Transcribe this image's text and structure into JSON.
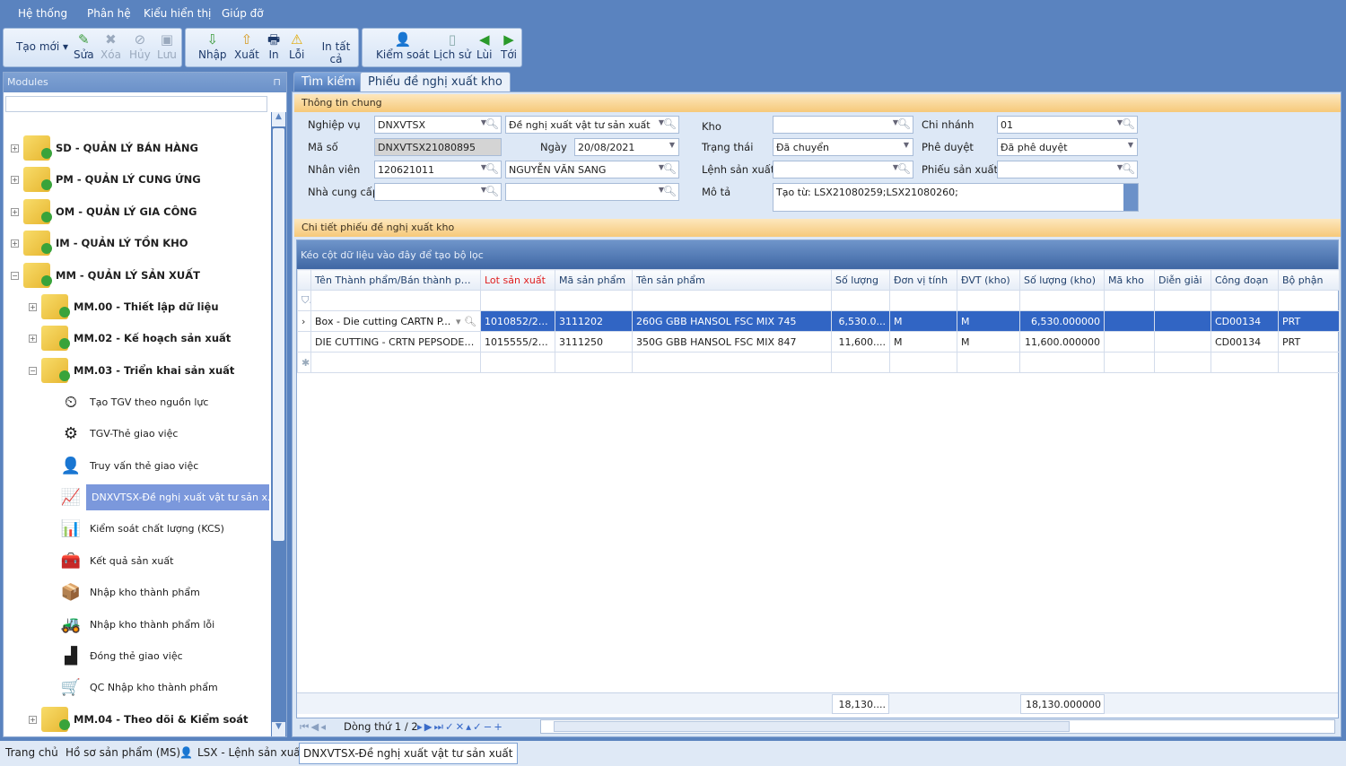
{
  "menu": [
    "Hệ thống",
    "Phân hệ",
    "Kiểu hiển thị",
    "Giúp đỡ"
  ],
  "toolbar": {
    "group1": [
      {
        "label": "Tạo mới ▾",
        "icon": "new-icon",
        "enabled": true
      },
      {
        "label": "Sửa",
        "icon": "pencil-icon",
        "enabled": true
      },
      {
        "label": "Xóa",
        "icon": "delete-icon",
        "enabled": false
      },
      {
        "label": "Hủy",
        "icon": "cancel-icon",
        "enabled": false
      },
      {
        "label": "Lưu",
        "icon": "save-icon",
        "enabled": false
      }
    ],
    "group2": [
      {
        "label": "Nhập",
        "icon": "import-icon"
      },
      {
        "label": "Xuất",
        "icon": "export-icon"
      },
      {
        "label": "In",
        "icon": "printer-icon"
      },
      {
        "label": "Lỗi",
        "icon": "warning-icon"
      },
      {
        "label": "In tất cả",
        "icon": ""
      }
    ],
    "group3": [
      {
        "label": "Kiểm soát",
        "icon": "user-icon"
      },
      {
        "label": "Lịch sử",
        "icon": "history-icon"
      },
      {
        "label": "Lùi",
        "icon": "back-icon"
      },
      {
        "label": "Tới",
        "icon": "forward-icon"
      }
    ]
  },
  "modules": {
    "title": "Modules",
    "pin": "⊓",
    "tree": [
      {
        "label": "SD - QUẢN LÝ BÁN HÀNG",
        "level": 0,
        "bold": true
      },
      {
        "label": "PM - QUẢN LÝ CUNG ỨNG",
        "level": 0,
        "bold": true
      },
      {
        "label": "OM - QUẢN LÝ GIA CÔNG",
        "level": 0,
        "bold": true
      },
      {
        "label": "IM - QUẢN LÝ TỒN KHO",
        "level": 0,
        "bold": true
      },
      {
        "label": "MM - QUẢN LÝ SẢN XUẤT",
        "level": 0,
        "bold": true
      },
      {
        "label": "MM.00 - Thiết lập dữ liệu",
        "level": 1,
        "bold": true
      },
      {
        "label": "MM.02 - Kế hoạch sản xuất",
        "level": 1,
        "bold": true
      },
      {
        "label": "MM.03 - Triển khai sản xuất",
        "level": 1,
        "bold": true
      },
      {
        "label": "Tạo TGV theo nguồn lực",
        "level": 2,
        "icon": "gauge-icon"
      },
      {
        "label": "TGV-Thẻ giao việc",
        "level": 2,
        "icon": "machine-icon"
      },
      {
        "label": "Truy vấn thẻ giao việc",
        "level": 2,
        "icon": "user-key-icon"
      },
      {
        "label": "DNXVTSX-Đề nghị xuất vật tư sản x...",
        "level": 2,
        "icon": "chart-board-icon",
        "selected": true
      },
      {
        "label": "Kiểm soát chất lượng (KCS)",
        "level": 2,
        "icon": "plan-icon"
      },
      {
        "label": "Kết quả sản xuất",
        "level": 2,
        "icon": "toolbox-icon"
      },
      {
        "label": "Nhập kho thành phẩm",
        "level": 2,
        "icon": "box-in-icon"
      },
      {
        "label": "Nhập kho thành phẩm lỗi",
        "level": 2,
        "icon": "forklift-icon"
      },
      {
        "label": "Đóng thẻ giao việc",
        "level": 2,
        "icon": "area-chart-icon"
      },
      {
        "label": "QC Nhập kho thành phẩm",
        "level": 2,
        "icon": "cart-icon"
      },
      {
        "label": "MM.04 - Theo dõi & Kiểm soát",
        "level": 1,
        "bold": true
      }
    ]
  },
  "tabs": [
    {
      "label": "Tìm kiếm",
      "active": false
    },
    {
      "label": "Phiếu đề nghị xuất kho",
      "active": true
    }
  ],
  "general": {
    "title": "Thông tin chung",
    "nghiep_vu_label": "Nghiệp vụ",
    "nghiep_vu_code": "DNXVTSX",
    "nghiep_vu_name": "Đề nghị xuất vật tư sản xuất",
    "ma_so_label": "Mã số",
    "ma_so": "DNXVTSX21080895",
    "ngay_label": "Ngày",
    "ngay": "20/08/2021",
    "nhan_vien_label": "Nhân viên",
    "nhan_vien_code": "120621011",
    "nhan_vien_name": "NGUYỄN VĂN SANG",
    "ncc_label": "Nhà cung cấp",
    "ncc_code": "",
    "ncc_name": "",
    "kho_label": "Kho",
    "kho": "",
    "trang_thai_label": "Trạng thái",
    "trang_thai": "Đã chuyển",
    "lsx_label": "Lệnh sản xuất",
    "lsx": "",
    "mo_ta_label": "Mô tả",
    "mo_ta": "Tạo từ: LSX21080259;LSX21080260;",
    "chi_nhanh_label": "Chi nhánh",
    "chi_nhanh": "01",
    "phe_duyet_label": "Phê duyệt",
    "phe_duyet": "Đã phê duyệt",
    "phieu_sx_label": "Phiếu sản xuất",
    "phieu_sx": ""
  },
  "detail": {
    "title": "Chi tiết phiếu đề nghị xuất kho",
    "group_hint": "Kéo cột dữ liệu vào đây để tạo bộ lọc",
    "columns": [
      "Tên Thành phẩm/Bán thành phẩm",
      "Lot sản xuất",
      "Mã sản phẩm",
      "Tên sản phẩm",
      "Số lượng",
      "Đơn vị tính",
      "ĐVT (kho)",
      "Số lượng (kho)",
      "Mã kho",
      "Diễn giải",
      "Công đoạn",
      "Bộ phận"
    ],
    "required_column_color": "#e02020",
    "rows": [
      [
        "Box - Die cutting CARTN P...",
        "1010852/21...",
        "3111202",
        "260G GBB HANSOL FSC MIX 745",
        "6,530.0...",
        "M",
        "M",
        "6,530.000000",
        "",
        "",
        "CD00134",
        "PRT"
      ],
      [
        "DIE CUTTING - CRTN PEPSODENT...",
        "1015555/21...",
        "3111250",
        "350G GBB HANSOL FSC MIX 847",
        "11,600....",
        "M",
        "M",
        "11,600.000000",
        "",
        "",
        "CD00134",
        "PRT"
      ]
    ],
    "sum_qty": "18,130....",
    "sum_qty_kho": "18,130.000000",
    "nav_text": "Dòng thứ 1 / 2"
  },
  "taskbar": [
    "Trang chủ",
    "Hồ sơ sản phẩm (MS)",
    "LSX - Lệnh sản xuất",
    "DNXVTSX-Đề nghị xuất vật tư sản xuất"
  ],
  "colors": {
    "accent": "#5a83bf",
    "selection": "#3165c4",
    "tree_selection": "#7b98dc",
    "group_header": "#f6c97a"
  }
}
